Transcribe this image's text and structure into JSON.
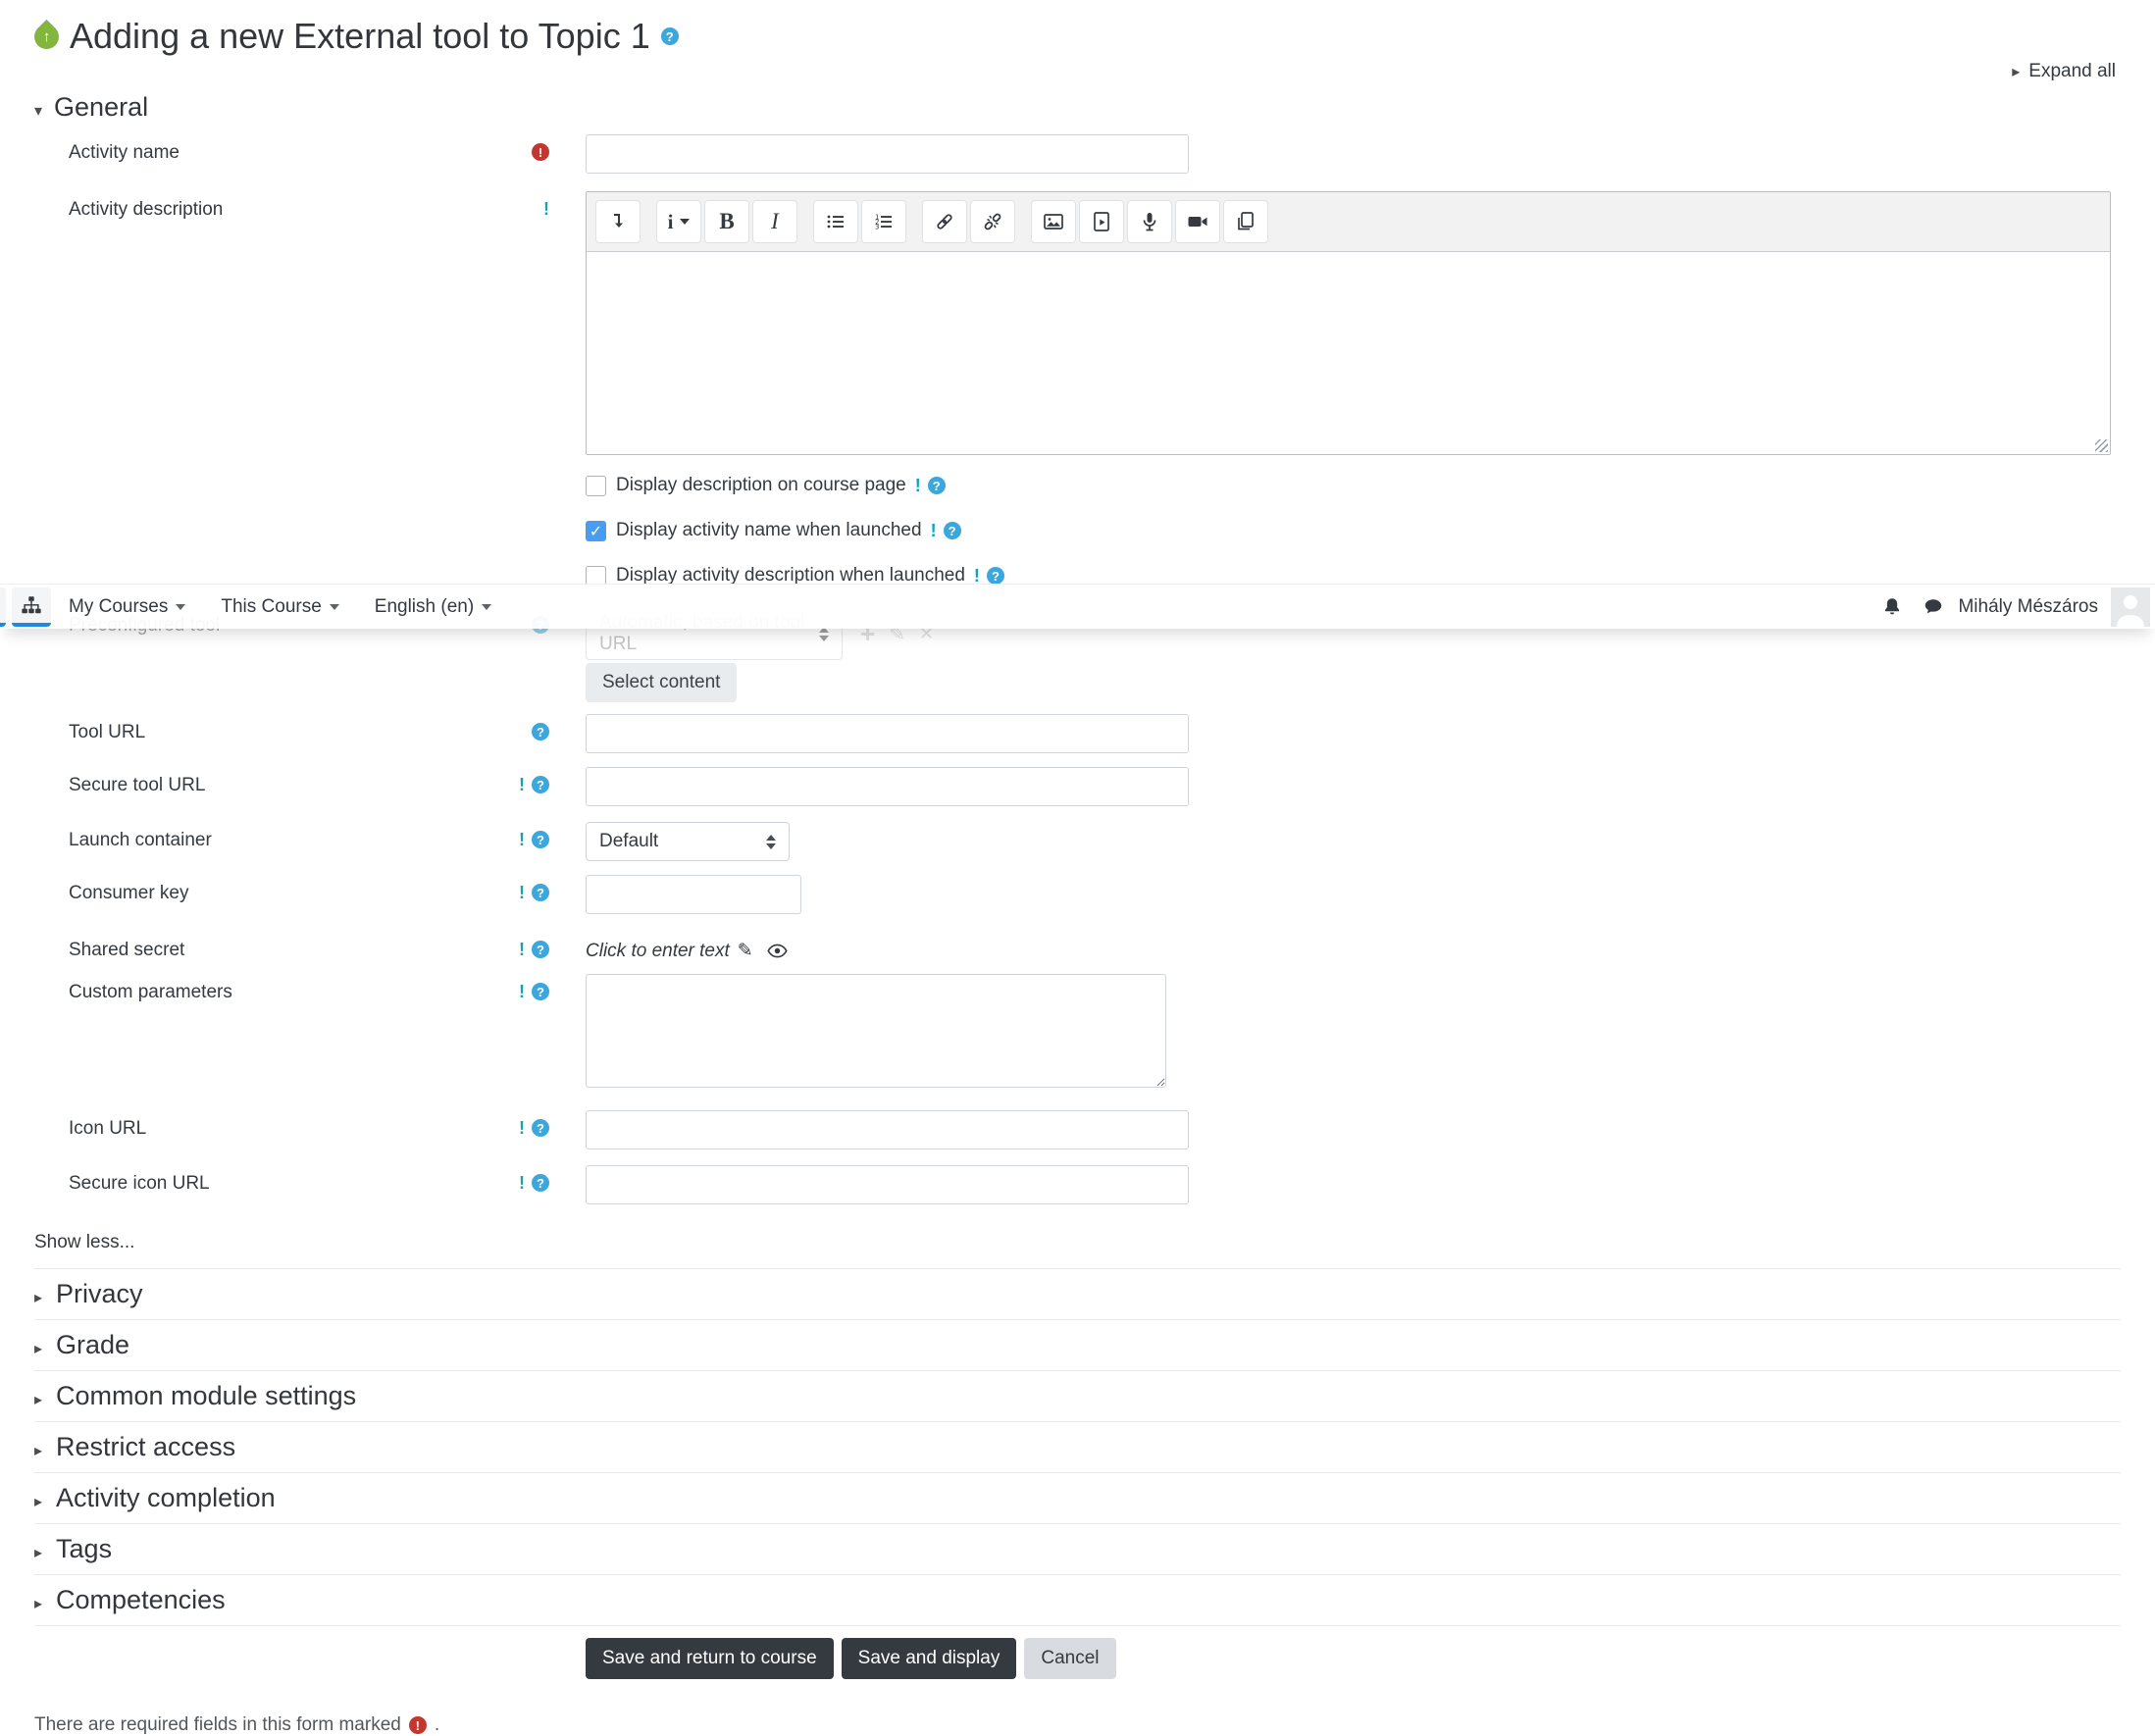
{
  "colors": {
    "accent": "#1e88e5",
    "help_icon": "#3ba7dc",
    "advanced_icon": "#12a3b8",
    "required_icon": "#c3382e",
    "tool_icon": "#84b63f",
    "dark_button": "#343a40",
    "checkbox_checked": "#4a9cf0"
  },
  "page": {
    "title": "Adding a new External tool to Topic 1",
    "expand_all": "Expand all"
  },
  "navbar": {
    "menu": [
      "My Courses",
      "This Course",
      "English (en)"
    ],
    "user": "Mihály Mészáros"
  },
  "general": {
    "heading": "General",
    "activity_name_label": "Activity name",
    "activity_description_label": "Activity description",
    "editor": {
      "styles_glyph": "i",
      "bold_glyph": "B",
      "italic_glyph": "I"
    },
    "checkboxes": [
      {
        "label": "Display description on course page",
        "checked": false
      },
      {
        "label": "Display activity name when launched",
        "checked": true
      },
      {
        "label": "Display activity description when launched",
        "checked": false
      }
    ],
    "preconfigured": {
      "label": "Preconfigured tool",
      "select_value": "Automatic, based on tool URL",
      "content_button": "Select content"
    },
    "fields": {
      "tool_url": "Tool URL",
      "secure_tool_url": "Secure tool URL",
      "launch_container": {
        "label": "Launch container",
        "value": "Default"
      },
      "consumer_key": "Consumer key",
      "shared_secret": {
        "label": "Shared secret",
        "value_text": "Click to enter text"
      },
      "custom_parameters": "Custom parameters",
      "icon_url": "Icon URL",
      "secure_icon_url": "Secure icon URL"
    },
    "show_less": "Show less..."
  },
  "sections": [
    "Privacy",
    "Grade",
    "Common module settings",
    "Restrict access",
    "Activity completion",
    "Tags",
    "Competencies"
  ],
  "actions": {
    "save_return": "Save and return to course",
    "save_display": "Save and display",
    "cancel": "Cancel"
  },
  "footer": {
    "text": "There are required fields in this form marked",
    "suffix": "."
  }
}
